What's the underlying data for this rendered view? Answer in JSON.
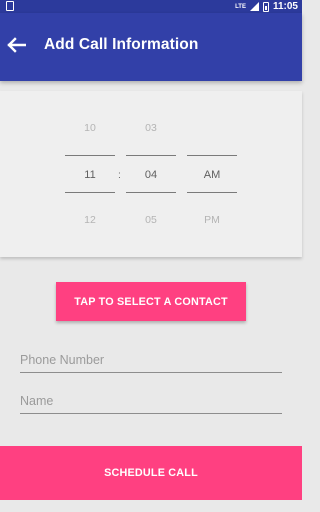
{
  "status_bar": {
    "network": "LTE",
    "time": "11:05"
  },
  "app_bar": {
    "title": "Add Call Information",
    "back_icon": "arrow-left-icon"
  },
  "time_picker": {
    "hour": {
      "prev": "10",
      "selected": "11",
      "next": "12"
    },
    "separator": ":",
    "minute": {
      "prev": "03",
      "selected": "04",
      "next": "05"
    },
    "ampm": {
      "selected": "AM",
      "next": "PM"
    }
  },
  "contact_button": {
    "label": "TAP TO SELECT A CONTACT"
  },
  "form": {
    "phone_placeholder": "Phone Number",
    "phone_value": "",
    "name_placeholder": "Name",
    "name_value": ""
  },
  "schedule_button": {
    "label": "SCHEDULE CALL"
  },
  "colors": {
    "primary": "#3240a8",
    "status_bar": "#2c3a9c",
    "accent": "#ff4081",
    "background": "#e9e9e9"
  }
}
